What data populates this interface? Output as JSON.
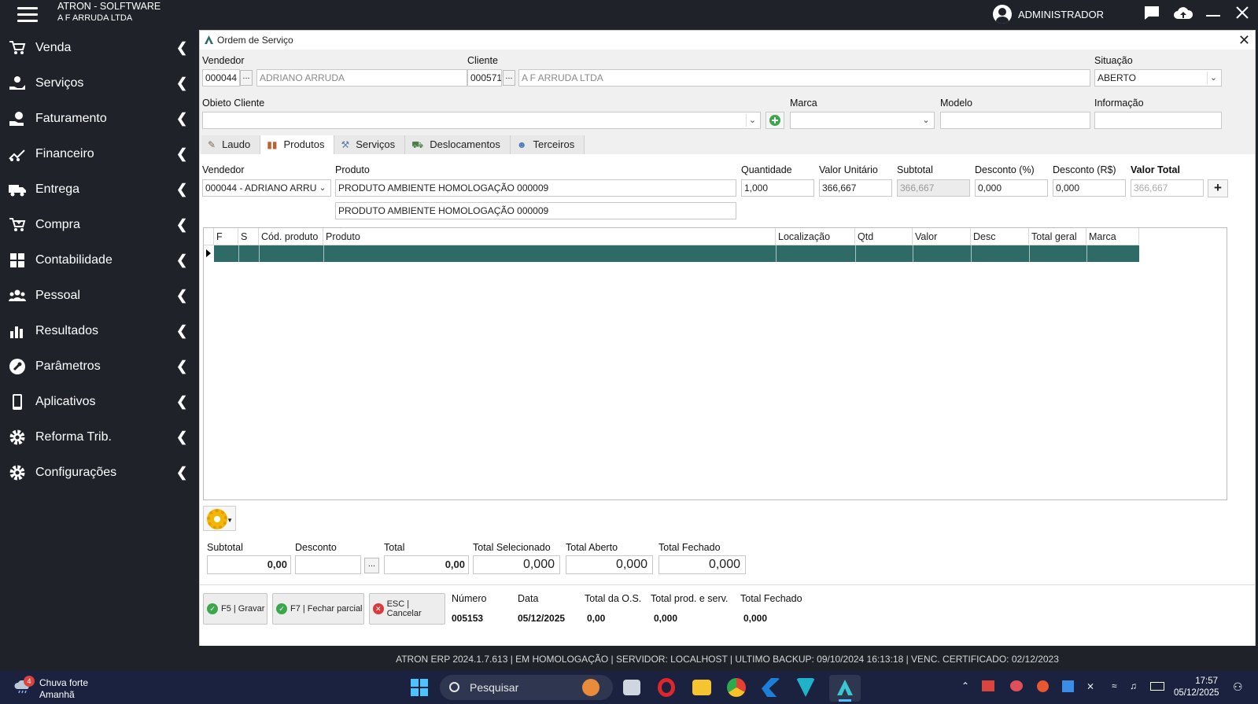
{
  "app": {
    "title": "ATRON - SOLFTWARE",
    "company": "A F ARRUDA  LTDA",
    "user": "ADMINISTRADOR"
  },
  "sidebar": {
    "items": [
      {
        "label": "Venda",
        "icon": "cart-icon"
      },
      {
        "label": "Serviços",
        "icon": "hand-service-icon"
      },
      {
        "label": "Faturamento",
        "icon": "invoice-icon"
      },
      {
        "label": "Financeiro",
        "icon": "finance-chart-icon"
      },
      {
        "label": "Entrega",
        "icon": "truck-icon"
      },
      {
        "label": "Compra",
        "icon": "cart-plus-icon"
      },
      {
        "label": "Contabilidade",
        "icon": "calculator-icon"
      },
      {
        "label": "Pessoal",
        "icon": "people-icon"
      },
      {
        "label": "Resultados",
        "icon": "bar-chart-icon"
      },
      {
        "label": "Parâmetros",
        "icon": "wrench-icon"
      },
      {
        "label": "Aplicativos",
        "icon": "phone-icon"
      },
      {
        "label": "Reforma Trib.",
        "icon": "gear-icon"
      },
      {
        "label": "Configurações",
        "icon": "gear-icon"
      }
    ]
  },
  "window": {
    "title": "Ordem de Serviço",
    "header": {
      "vendedor_label": "Vendedor",
      "vendedor_code": "000044",
      "vendedor_name": "ADRIANO ARRUDA",
      "cliente_label": "Cliente",
      "cliente_code": "000571",
      "cliente_name": "A F ARRUDA  LTDA",
      "situacao_label": "Situação",
      "situacao_value": "ABERTO",
      "objeto_label": "Obieto Cliente",
      "objeto_value": "",
      "marca_label": "Marca",
      "marca_value": "",
      "modelo_label": "Modelo",
      "modelo_value": "",
      "informacao_label": "Informação",
      "informacao_value": "",
      "dots": "..."
    },
    "tabs": [
      {
        "label": "Laudo",
        "icon": "pen-icon"
      },
      {
        "label": "Produtos",
        "icon": "books-icon"
      },
      {
        "label": "Serviços",
        "icon": "tools-icon"
      },
      {
        "label": "Deslocamentos",
        "icon": "truck-icon"
      },
      {
        "label": "Terceiros",
        "icon": "person-icon"
      }
    ],
    "product_form": {
      "vendedor_label": "Vendedor",
      "vendedor_value": "000044 - ADRIANO ARRU",
      "produto_label": "Produto",
      "produto_value": "PRODUTO AMBIENTE HOMOLOGAÇÃO 000009",
      "produto_desc": "PRODUTO AMBIENTE HOMOLOGAÇÃO 000009",
      "quantidade_label": "Quantidade",
      "quantidade_value": "1,000",
      "valor_unitario_label": "Valor Unitário",
      "valor_unitario_value": "366,667",
      "subtotal_label": "Subtotal",
      "subtotal_value": "366,667",
      "desconto_pct_label": "Desconto (%)",
      "desconto_pct_value": "0,000",
      "desconto_rs_label": "Desconto (R$)",
      "desconto_rs_value": "0,000",
      "valor_total_label": "Valor Total",
      "valor_total_value": "366,667",
      "add_label": "+"
    },
    "grid": {
      "columns": [
        "F",
        "S",
        "Cód. produto",
        "Produto",
        "Localização",
        "Qtd",
        "Valor",
        "Desc",
        "Total geral",
        "Marca"
      ]
    },
    "totals": {
      "subtotal_label": "Subtotal",
      "subtotal_value": "0,00",
      "desconto_label": "Desconto",
      "desconto_value": "",
      "total_label": "Total",
      "total_value": "0,00",
      "total_sel_label": "Total Selecionado",
      "total_sel_value": "0,000",
      "total_aberto_label": "Total Aberto",
      "total_aberto_value": "0,000",
      "total_fechado_label": "Total Fechado",
      "total_fechado_value": "0,000"
    },
    "buttons": {
      "gravar": "F5 | Gravar",
      "fechar_parcial": "F7 | Fechar parcial",
      "cancelar": "ESC | Cancelar"
    },
    "footer": {
      "numero_label": "Número",
      "numero_value": "005153",
      "data_label": "Data",
      "data_value": "05/12/2025",
      "total_os_label": "Total da O.S.",
      "total_os_value": "0,00",
      "total_ps_label": "Total prod. e serv.",
      "total_ps_value": "0,000",
      "total_fechado_label": "Total Fechado",
      "total_fechado_value": "0,000"
    }
  },
  "statusbar": "ATRON ERP 2024.1.7.613 | EM HOMOLOGAÇÃO | SERVIDOR: LOCALHOST | ULTIMO BACKUP: 09/10/2024 16:13:18 | VENC. CERTIFICADO: 02/12/2023",
  "taskbar": {
    "weather_title": "Chuva forte",
    "weather_sub": "Amanhã",
    "weather_badge": "4",
    "search_placeholder": "Pesquisar",
    "time": "17:57",
    "date": "05/12/2025"
  },
  "colors": {
    "sidebar_bg": "#1f2329",
    "selected_row": "#2e6b66",
    "taskbar_bg": "#1a2240"
  }
}
